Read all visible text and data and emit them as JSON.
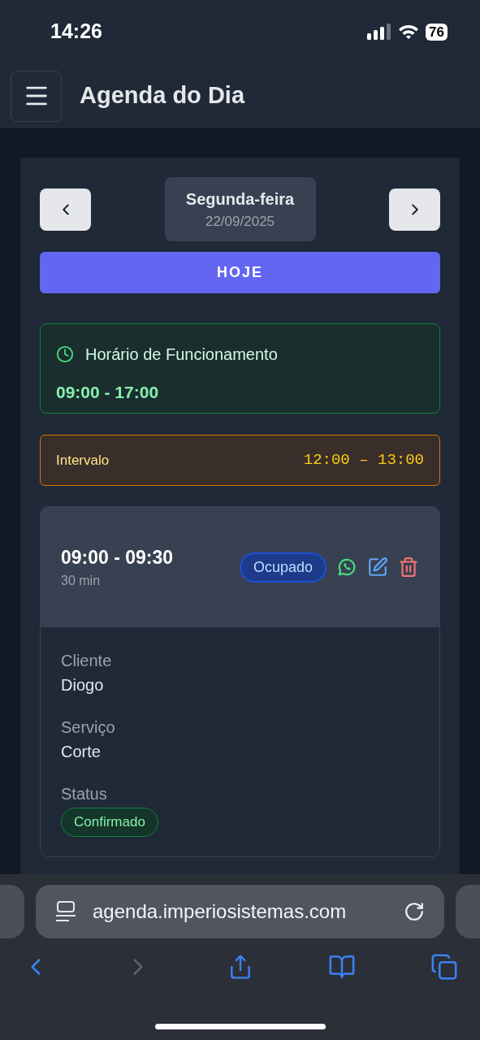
{
  "status_bar": {
    "time": "14:26",
    "battery": "76"
  },
  "header": {
    "title": "Agenda do Dia"
  },
  "date_nav": {
    "weekday": "Segunda-feira",
    "date": "22/09/2025",
    "today_button": "HOJE"
  },
  "opening_hours": {
    "title": "Horário de Funcionamento",
    "hours": "09:00 - 17:00"
  },
  "break": {
    "label": "Intervalo",
    "time": "12:00 – 13:00"
  },
  "appointments": [
    {
      "time": "09:00 - 09:30",
      "duration": "30 min",
      "status": "Ocupado",
      "fields": [
        {
          "kind": "text",
          "label": "Cliente",
          "value": "Diogo"
        },
        {
          "kind": "text",
          "label": "Serviço",
          "value": "Corte"
        },
        {
          "kind": "badge",
          "label": "Status",
          "value": "Confirmado"
        }
      ]
    }
  ],
  "browser": {
    "url": "agenda.imperiosistemas.com",
    "buttons": [
      {
        "kind": "back",
        "disabled": false
      },
      {
        "kind": "forward",
        "disabled": true
      },
      {
        "kind": "share",
        "disabled": false
      },
      {
        "kind": "bookmarks",
        "disabled": false
      },
      {
        "kind": "tabs",
        "disabled": false
      }
    ]
  }
}
